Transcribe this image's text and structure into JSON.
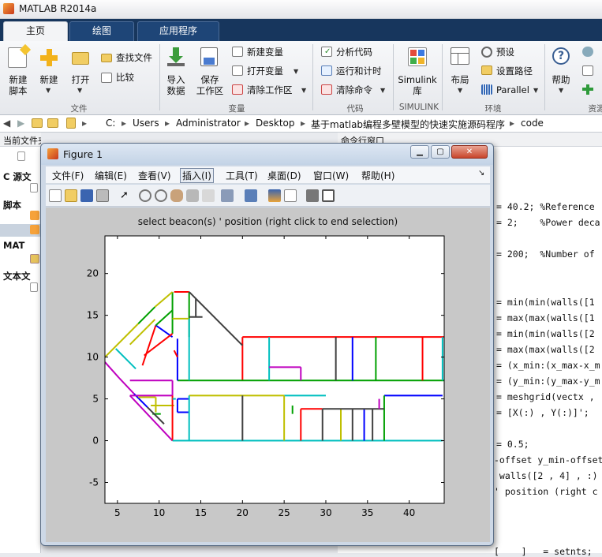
{
  "app": {
    "title": "MATLAB R2014a"
  },
  "tabs": [
    {
      "label": "主页"
    },
    {
      "label": "绘图"
    },
    {
      "label": "应用程序"
    }
  ],
  "ribbon": {
    "new_script": "新建\n脚本",
    "new_script_l1": "新建",
    "new_script_l2": "脚本",
    "new": "新建",
    "open": "打开",
    "find_files": "查找文件",
    "compare": "比较",
    "import_l1": "导入",
    "import_l2": "数据",
    "save_l1": "保存",
    "save_l2": "工作区",
    "new_var": "新建变量",
    "open_var": "打开变量",
    "clear_ws": "清除工作区",
    "analyze": "分析代码",
    "run_time": "运行和计时",
    "clear_cmd": "清除命令",
    "simulink_l1": "Simulink",
    "simulink_l2": "库",
    "layout": "布局",
    "prefs": "预设",
    "set_path": "设置路径",
    "parallel": "Parallel",
    "help": "帮助",
    "groups": {
      "file": "文件",
      "variable": "变量",
      "code": "代码",
      "simulink": "SIMULINK",
      "env": "环境",
      "resources": "资源"
    }
  },
  "address": {
    "crumbs": [
      "C:",
      "Users",
      "Administrator",
      "Desktop",
      "基于matlab编程多壁模型的快速实施源码程序",
      "code"
    ]
  },
  "left_pane": {
    "header": "当前文件夹",
    "items": [
      "C 源文",
      "脚本",
      "MAT",
      "文本文"
    ]
  },
  "cmd_pane": {
    "header": "命令行窗口",
    "lines": [
      "= 40.2; %Reference",
      "= 2;    %Power deca",
      "= 200;  %Number of",
      "= min(min(walls([1",
      "= max(max(walls([1",
      "= min(min(walls([2",
      "= max(max(walls([2",
      "= (x_min:(x_max-x_m",
      "= (y_min:(y_max-y_m",
      "= meshgrid(vectx ,",
      "= [X(:) , Y(:)]';",
      "= 0.5;",
      "-offset y_min-offset",
      " walls([2 , 4] , :)",
      "' position (right c",
      "[    ]   = setnts;"
    ]
  },
  "figure": {
    "title": "Figure 1",
    "menu": [
      "文件(F)",
      "编辑(E)",
      "查看(V)",
      "插入(I)",
      "工具(T)",
      "桌面(D)",
      "窗口(W)",
      "帮助(H)"
    ],
    "plot_title": "select beacon(s) ' position (right click to end selection)"
  },
  "chart_data": {
    "type": "line",
    "title": "select beacon(s) ' position (right click to end selection)",
    "xlabel": "",
    "ylabel": "",
    "xlim": [
      3.5,
      44.2
    ],
    "ylim": [
      -7.5,
      24.5
    ],
    "xticks": [
      5,
      10,
      15,
      20,
      25,
      30,
      35,
      40
    ],
    "yticks": [
      -5,
      0,
      5,
      10,
      15,
      20
    ],
    "grid": false,
    "colors": [
      "#0000ff",
      "#00a000",
      "#ff0000",
      "#00bfbf",
      "#bf00bf",
      "#bfbf00",
      "#404040"
    ],
    "walls": [
      [
        20,
        12.4,
        44.2,
        12.4,
        2
      ],
      [
        20,
        7.2,
        20,
        12.4,
        2
      ],
      [
        12.2,
        7.2,
        44.2,
        7.2,
        1
      ],
      [
        23.2,
        7.2,
        23.2,
        12.4,
        3
      ],
      [
        23.2,
        8.8,
        27,
        8.8,
        4
      ],
      [
        27,
        7.2,
        27,
        8.8,
        4
      ],
      [
        31.2,
        7.2,
        31.2,
        12.4,
        6
      ],
      [
        33.2,
        7.2,
        33.2,
        12.4,
        0
      ],
      [
        36,
        7.2,
        36,
        12.4,
        1
      ],
      [
        41.6,
        7.2,
        41.6,
        12.4,
        2
      ],
      [
        44,
        7.2,
        44,
        12.4,
        3
      ],
      [
        11.8,
        17.8,
        13.6,
        17.8,
        2
      ],
      [
        11.6,
        17.8,
        11.6,
        12.8,
        1
      ],
      [
        13.6,
        17.8,
        13.6,
        12.4,
        1
      ],
      [
        13.6,
        17.8,
        20,
        11.4,
        6
      ],
      [
        14.4,
        14.8,
        14.4,
        17,
        6
      ],
      [
        13.6,
        14.8,
        15.2,
        14.8,
        6
      ],
      [
        11.6,
        14.6,
        13.6,
        14.6,
        5
      ],
      [
        13.6,
        14.6,
        13.6,
        7.2,
        3
      ],
      [
        12.2,
        12.2,
        12.2,
        7.2,
        0
      ],
      [
        11.8,
        10.8,
        12.2,
        10,
        2
      ],
      [
        3.5,
        10,
        7.5,
        14,
        5
      ],
      [
        7.5,
        14,
        9.5,
        16,
        1
      ],
      [
        9.5,
        16,
        11.6,
        17.8,
        5
      ],
      [
        6.5,
        11.5,
        9.5,
        14.5,
        5
      ],
      [
        8,
        9,
        9.6,
        13.8,
        2
      ],
      [
        9.6,
        13.8,
        11.6,
        12.4,
        0
      ],
      [
        9.6,
        13.8,
        11.6,
        15.6,
        1
      ],
      [
        8.2,
        10.2,
        11.6,
        12.8,
        2
      ],
      [
        4.8,
        11,
        6.6,
        9.2,
        3
      ],
      [
        6.6,
        9.2,
        7.2,
        8.6,
        3
      ],
      [
        3.5,
        9.4,
        5.2,
        7.5,
        4
      ],
      [
        5.2,
        7.5,
        7,
        5.6,
        4
      ],
      [
        7,
        5.6,
        8.6,
        4,
        0
      ],
      [
        6.5,
        7.2,
        11.6,
        7.2,
        4
      ],
      [
        6.5,
        5.4,
        11.6,
        5.4,
        4
      ],
      [
        11.6,
        7.2,
        11.6,
        5.4,
        4
      ],
      [
        6.5,
        5.4,
        11.6,
        0,
        4
      ],
      [
        7.5,
        5.2,
        9.6,
        5.2,
        5
      ],
      [
        9.6,
        5.2,
        9.6,
        3.4,
        5
      ],
      [
        9,
        4.2,
        11.8,
        4.2,
        5
      ],
      [
        9.2,
        3.2,
        10.2,
        3.2,
        1
      ],
      [
        8.6,
        4,
        10.6,
        2,
        6
      ],
      [
        11.6,
        5.4,
        11.6,
        0,
        2
      ],
      [
        11.6,
        0,
        44,
        0,
        3
      ],
      [
        11.6,
        5,
        12,
        5,
        3
      ],
      [
        12.2,
        5,
        13.6,
        5,
        0
      ],
      [
        12.2,
        5,
        12.2,
        3.4,
        0
      ],
      [
        12.2,
        3.4,
        13.6,
        3.4,
        0
      ],
      [
        13.6,
        5.4,
        25,
        5.4,
        5
      ],
      [
        25,
        5.4,
        30,
        5.4,
        3
      ],
      [
        13.6,
        5.4,
        13.6,
        0,
        3
      ],
      [
        20,
        5.4,
        20,
        0,
        6
      ],
      [
        25,
        5.4,
        25,
        0,
        5
      ],
      [
        27,
        3.8,
        29.6,
        3.8,
        2
      ],
      [
        27,
        3.8,
        27,
        0,
        2
      ],
      [
        29.6,
        3.8,
        29.6,
        0,
        6
      ],
      [
        31.8,
        3.8,
        31.8,
        0,
        5
      ],
      [
        33.2,
        3.8,
        33.2,
        0,
        6
      ],
      [
        34.6,
        3.8,
        34.6,
        0,
        0
      ],
      [
        35.6,
        3.8,
        35.6,
        0,
        6
      ],
      [
        37,
        5.4,
        44,
        5.4,
        0
      ],
      [
        37,
        5.4,
        37,
        0,
        1
      ],
      [
        29.6,
        3.8,
        37,
        3.8,
        6
      ],
      [
        36.4,
        5,
        36.4,
        3.8,
        4
      ],
      [
        26,
        4.2,
        26,
        3.2,
        1
      ]
    ]
  }
}
